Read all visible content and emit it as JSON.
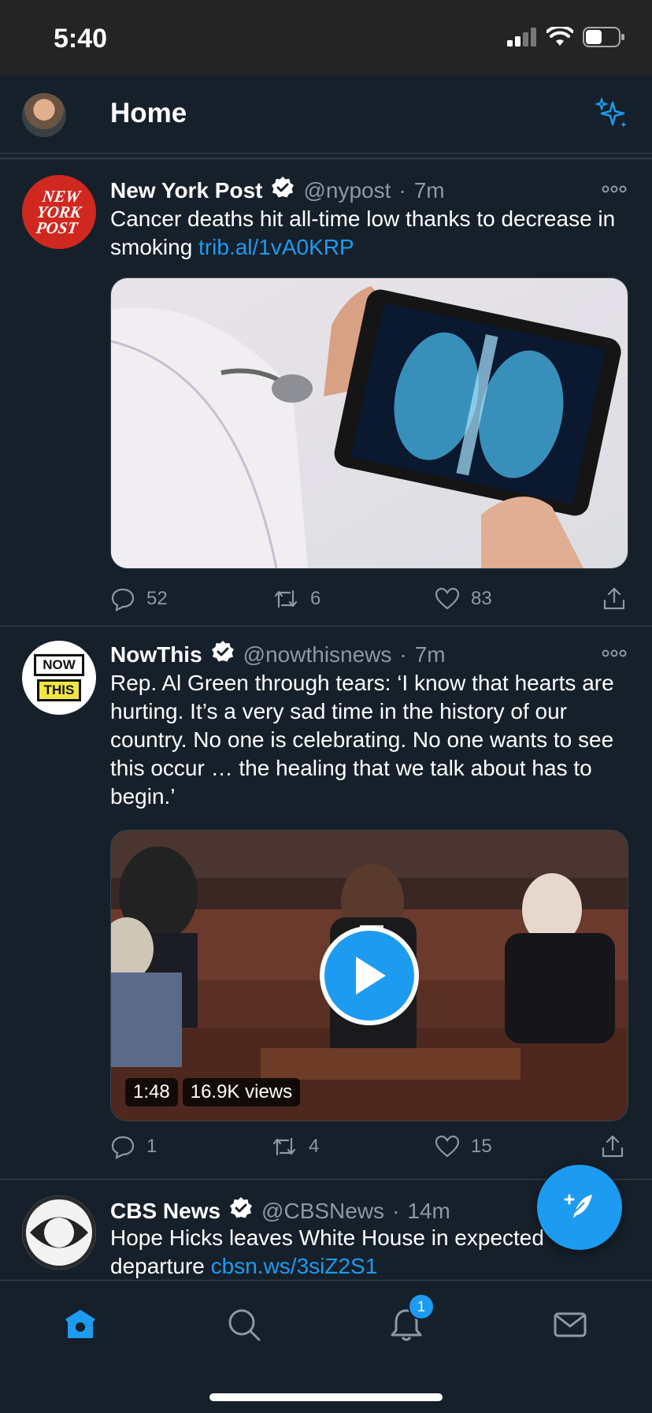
{
  "status_bar": {
    "time": "5:40"
  },
  "header": {
    "title": "Home"
  },
  "tweets": [
    {
      "name": "New York Post",
      "handle": "@nypost",
      "dot": "·",
      "time": "7m",
      "text": "Cancer deaths hit all-time low thanks to decrease in smoking ",
      "link": "trib.al/1vA0KRP",
      "avatar_text": [
        "NEW",
        "YORK",
        "POST"
      ],
      "replies": "52",
      "retweets": "6",
      "likes": "83"
    },
    {
      "name": "NowThis",
      "handle": "@nowthisnews",
      "dot": "·",
      "time": "7m",
      "text": "Rep. Al Green through tears: ‘I know that hearts are hurting. It’s a very sad time in the history of our country. No one is celebrating. No one wants to see this occur … the healing that we talk about has to begin.’",
      "avatar_text": [
        "NOW",
        "THIS"
      ],
      "video_duration": "1:48",
      "video_views": "16.9K views",
      "replies": "1",
      "retweets": "4",
      "likes": "15"
    },
    {
      "name": "CBS News",
      "handle": "@CBSNews",
      "dot": "·",
      "time": "14m",
      "text": "Hope Hicks leaves White House in expected departure ",
      "link": "cbsn.ws/3siZ2S1"
    }
  ],
  "tab_bar": {
    "notifications_count": "1"
  },
  "colors": {
    "background": "#15202b",
    "accent": "#1d9bf0",
    "muted": "#8b98a5"
  }
}
